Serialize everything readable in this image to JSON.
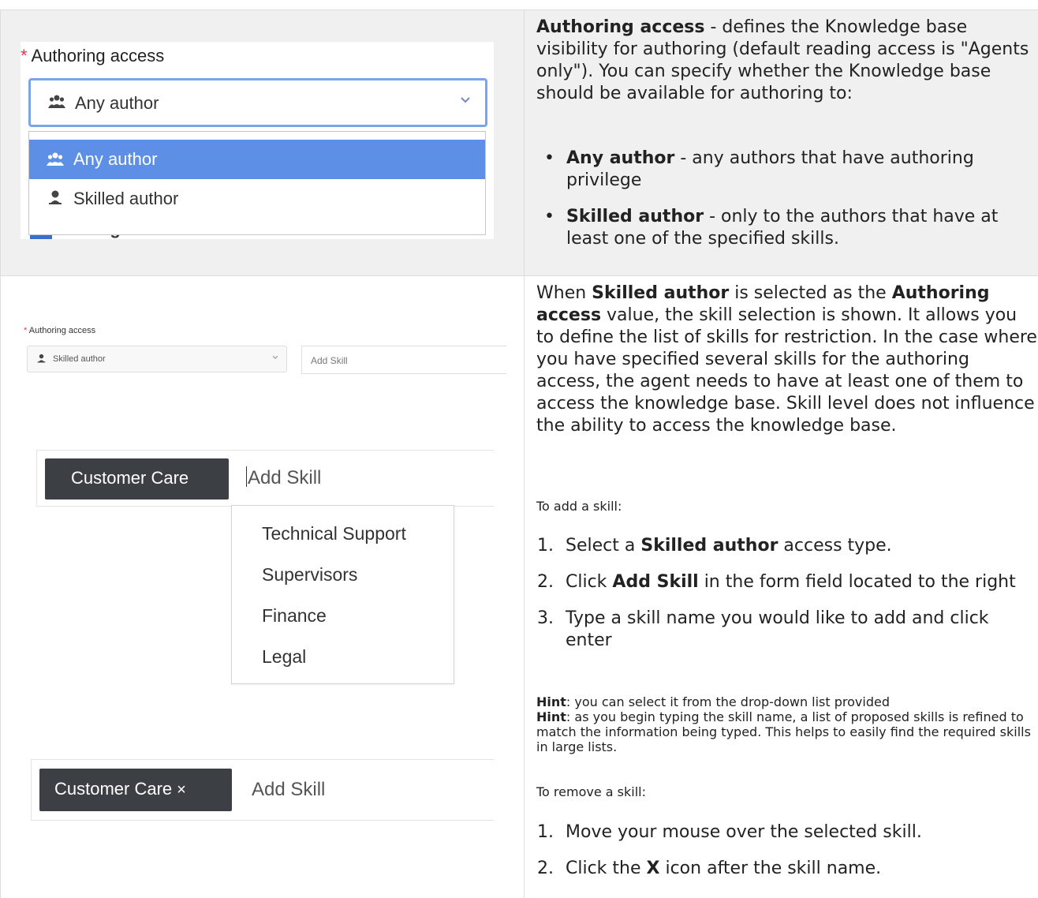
{
  "top_row": {
    "panel": {
      "required_mark": "*",
      "label": "Authoring access",
      "selected_value": "Any author",
      "options": [
        "Any author",
        "Skilled author"
      ],
      "behind_text": "Voting allowed",
      "icons": [
        "people-icon",
        "chevron-down-icon",
        "person-icon"
      ]
    },
    "description": {
      "term": "Authoring access",
      "text": " - defines the Knowledge base visibility for authoring (default reading access is \"Agents only\"). You can specify whether the Knowledge base should be available for authoring to:",
      "bullets": [
        {
          "term": "Any author",
          "text": " - any authors that have authoring privilege"
        },
        {
          "term": "Skilled author",
          "text": " - only to the authors that have at least one of the specified skills."
        }
      ]
    }
  },
  "bottom_row": {
    "panel_select": {
      "required_mark": "*",
      "label": "Authoring access",
      "value": "Skilled author",
      "add_skill_placeholder": "Add Skill"
    },
    "panel_dropdown": {
      "tag": "Customer Care",
      "input_placeholder": "Add Skill",
      "options": [
        "Technical Support",
        "Supervisors",
        "Finance",
        "Legal"
      ]
    },
    "panel_remove": {
      "tag": "Customer Care",
      "remove_glyph": "×",
      "input_placeholder": "Add Skill"
    },
    "description": {
      "intro_1": "When ",
      "intro_term1": "Skilled author",
      "intro_2": " is selected as the ",
      "intro_term2": "Authoring access",
      "intro_3": " value, the skill selection is shown. It allows you to define the list of skills for restriction. In the case where you have specified several skills for the authoring access, the agent needs to have at least one of them to access the knowledge base. Skill level does not influence the ability to access the knowledge base.",
      "add_heading": "To add a skill:",
      "add_steps": [
        {
          "num": "1.",
          "pre": "Select a ",
          "term": "Skilled author",
          "post": " access type."
        },
        {
          "num": "2.",
          "pre": "Click ",
          "term": "Add Skill",
          "post": " in the form field located to the right"
        },
        {
          "num": "3.",
          "pre": "Type a skill name you would like to add and click enter",
          "term": "",
          "post": ""
        }
      ],
      "hint1_term": "Hint",
      "hint1_text": ": you can select it from the drop-down list provided",
      "hint2_term": "Hint",
      "hint2_text": ": as you begin typing the skill name, a list of proposed skills is refined to match the information being typed. This helps to easily find the required skills in large lists.",
      "remove_heading": "To remove a skill:",
      "remove_steps": [
        {
          "num": "1.",
          "pre": "Move your mouse over the selected skill.",
          "term": "",
          "post": ""
        },
        {
          "num": "2.",
          "pre": "Click the ",
          "term": "X",
          "post": " icon after the skill name."
        }
      ]
    }
  }
}
